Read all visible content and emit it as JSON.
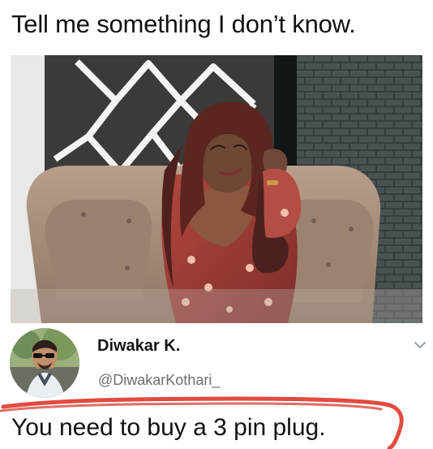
{
  "meme": {
    "caption": "Tell me something I don’t know."
  },
  "tweet": {
    "display_name": "Diwakar K.",
    "handle": "@DiwakarKothari_",
    "reply_text": "You need to buy a 3 pin plug."
  },
  "icons": {
    "avatar": "profile-avatar",
    "menu": "chevron-down-icon",
    "power_outlet": "wall-socket-icon"
  },
  "colors": {
    "highlight_circle": "#e24b3f",
    "handle_text": "#6b6f73"
  }
}
